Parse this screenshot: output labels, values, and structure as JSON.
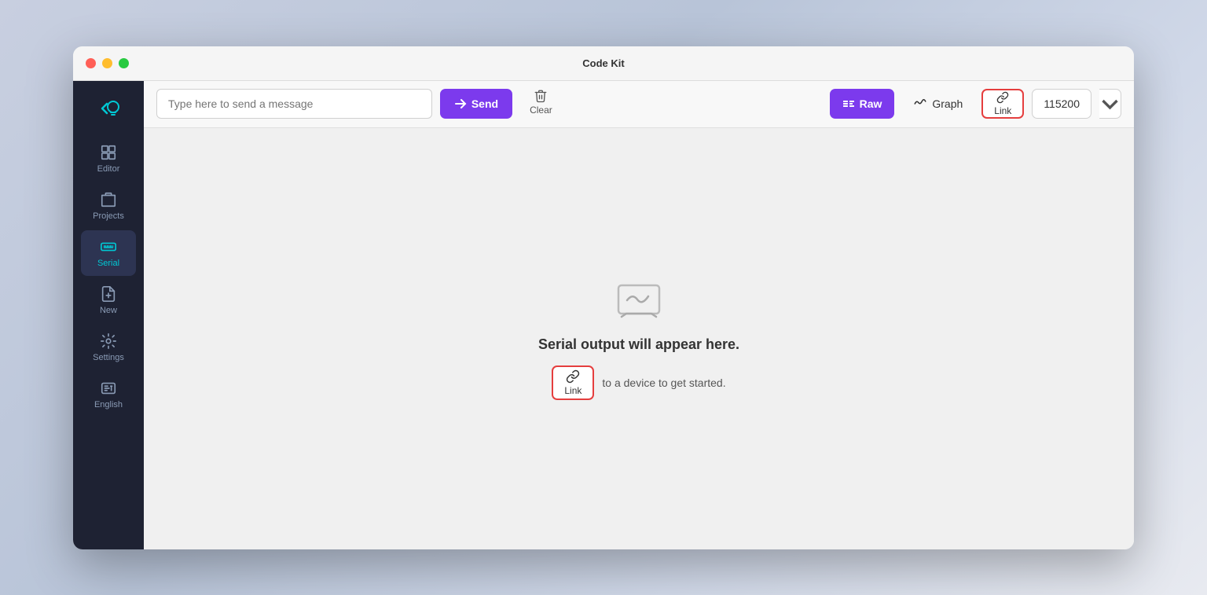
{
  "window": {
    "title": "Code Kit"
  },
  "sidebar": {
    "items": [
      {
        "id": "editor",
        "label": "Editor",
        "active": false
      },
      {
        "id": "projects",
        "label": "Projects",
        "active": false
      },
      {
        "id": "serial",
        "label": "Serial",
        "active": true
      },
      {
        "id": "new",
        "label": "New",
        "active": false
      },
      {
        "id": "settings",
        "label": "Settings",
        "active": false
      },
      {
        "id": "english",
        "label": "English",
        "active": false
      }
    ]
  },
  "toolbar": {
    "message_placeholder": "Type here to send a message",
    "send_label": "Send",
    "clear_label": "Clear",
    "raw_label": "Raw",
    "graph_label": "Graph",
    "link_label": "Link",
    "baud_rate": "115200"
  },
  "main": {
    "empty_state_title": "Serial output will appear here.",
    "empty_state_subtitle": "to a device to get started.",
    "link_button_label": "Link"
  }
}
